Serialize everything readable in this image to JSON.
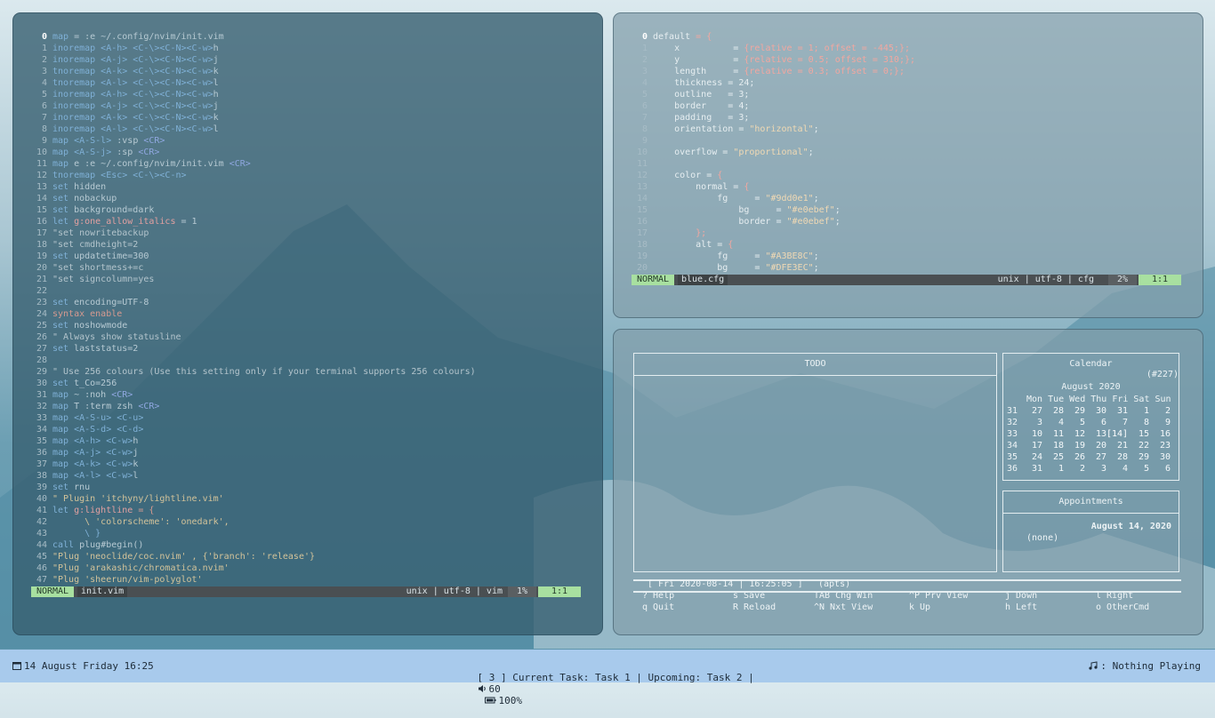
{
  "left": {
    "lines": [
      [
        {
          "t": "map",
          "c": "k"
        },
        {
          "t": " = :e ~/.config/nvim/init.vim",
          "c": "ct"
        }
      ],
      [
        {
          "t": "inoremap <A-h> <C-\\><C-N><C-w>",
          "c": "k"
        },
        {
          "t": "h",
          "c": "ct"
        }
      ],
      [
        {
          "t": "inoremap <A-j> <C-\\><C-N><C-w>",
          "c": "k"
        },
        {
          "t": "j",
          "c": "ct"
        }
      ],
      [
        {
          "t": "tnoremap <A-k> <C-\\><C-N><C-w>",
          "c": "k"
        },
        {
          "t": "k",
          "c": "ct"
        }
      ],
      [
        {
          "t": "tnoremap <A-l> <C-\\><C-N><C-w>",
          "c": "k"
        },
        {
          "t": "l",
          "c": "ct"
        }
      ],
      [
        {
          "t": "inoremap <A-h> <C-\\><C-N><C-w>",
          "c": "k"
        },
        {
          "t": "h",
          "c": "ct"
        }
      ],
      [
        {
          "t": "inoremap <A-j> <C-\\><C-N><C-w>",
          "c": "k"
        },
        {
          "t": "j",
          "c": "ct"
        }
      ],
      [
        {
          "t": "inoremap <A-k> <C-\\><C-N><C-w>",
          "c": "k"
        },
        {
          "t": "k",
          "c": "ct"
        }
      ],
      [
        {
          "t": "inoremap <A-l> <C-\\><C-N><C-w>",
          "c": "k"
        },
        {
          "t": "l",
          "c": "ct"
        }
      ],
      [
        {
          "t": "map <A-S-l>",
          "c": "k"
        },
        {
          "t": " :vsp ",
          "c": "ct"
        },
        {
          "t": "<CR>",
          "c": "m"
        }
      ],
      [
        {
          "t": "map <A-S-j>",
          "c": "k"
        },
        {
          "t": " :sp ",
          "c": "ct"
        },
        {
          "t": "<CR>",
          "c": "m"
        }
      ],
      [
        {
          "t": "map",
          "c": "k"
        },
        {
          "t": " e :e ~/.config/nvim/init.vim ",
          "c": "ct"
        },
        {
          "t": "<CR>",
          "c": "m"
        }
      ],
      [
        {
          "t": "tnoremap <Esc> <C-\\><C-n>",
          "c": "k"
        }
      ],
      [
        {
          "t": "set",
          "c": "k"
        },
        {
          "t": " hidden",
          "c": "ct"
        }
      ],
      [
        {
          "t": "set",
          "c": "k"
        },
        {
          "t": " nobackup",
          "c": "ct"
        }
      ],
      [
        {
          "t": "set",
          "c": "k"
        },
        {
          "t": " background=dark",
          "c": "ct"
        }
      ],
      [
        {
          "t": "let",
          "c": "k"
        },
        {
          "t": " g:one_allow_italics",
          "c": "n"
        },
        {
          "t": " = 1",
          "c": "ct"
        }
      ],
      [
        {
          "t": "\"set nowritebackup",
          "c": "c"
        }
      ],
      [
        {
          "t": "\"set cmdheight=2",
          "c": "c"
        }
      ],
      [
        {
          "t": "set",
          "c": "k"
        },
        {
          "t": " updatetime=300",
          "c": "ct"
        }
      ],
      [
        {
          "t": "\"set shortmess+=c",
          "c": "c"
        }
      ],
      [
        {
          "t": "\"set signcolumn=yes",
          "c": "c"
        }
      ],
      [
        {
          "t": "",
          "c": "ct"
        }
      ],
      [
        {
          "t": "set",
          "c": "k"
        },
        {
          "t": " encoding=UTF-8",
          "c": "ct"
        }
      ],
      [
        {
          "t": "syntax",
          "c": "o"
        },
        {
          "t": " enable",
          "c": "o"
        }
      ],
      [
        {
          "t": "set",
          "c": "k"
        },
        {
          "t": " noshowmode",
          "c": "ct"
        }
      ],
      [
        {
          "t": "\" Always show statusline",
          "c": "c"
        }
      ],
      [
        {
          "t": "set",
          "c": "k"
        },
        {
          "t": " laststatus=2",
          "c": "ct"
        }
      ],
      [
        {
          "t": "",
          "c": "ct"
        }
      ],
      [
        {
          "t": "\" Use 256 colours (Use this setting only if your terminal supports 256 colours)",
          "c": "c"
        }
      ],
      [
        {
          "t": "set",
          "c": "k"
        },
        {
          "t": " t_Co=256",
          "c": "ct"
        }
      ],
      [
        {
          "t": "map",
          "c": "k"
        },
        {
          "t": " ~ :noh ",
          "c": "ct"
        },
        {
          "t": "<CR>",
          "c": "m"
        }
      ],
      [
        {
          "t": "map",
          "c": "k"
        },
        {
          "t": " T :term zsh ",
          "c": "ct"
        },
        {
          "t": "<CR>",
          "c": "m"
        }
      ],
      [
        {
          "t": "map <A-S-u> <C-u>",
          "c": "k"
        }
      ],
      [
        {
          "t": "map <A-S-d> <C-d>",
          "c": "k"
        }
      ],
      [
        {
          "t": "map <A-h> <C-w>",
          "c": "k"
        },
        {
          "t": "h",
          "c": "ct"
        }
      ],
      [
        {
          "t": "map <A-j> <C-w>",
          "c": "k"
        },
        {
          "t": "j",
          "c": "ct"
        }
      ],
      [
        {
          "t": "map <A-k> <C-w>",
          "c": "k"
        },
        {
          "t": "k",
          "c": "ct"
        }
      ],
      [
        {
          "t": "map <A-l> <C-w>",
          "c": "k"
        },
        {
          "t": "l",
          "c": "ct"
        }
      ],
      [
        {
          "t": "set",
          "c": "k"
        },
        {
          "t": " rnu",
          "c": "ct"
        }
      ],
      [
        {
          "t": "\" Plugin 'itchyny/lightline.vim'",
          "c": "s"
        }
      ],
      [
        {
          "t": "let",
          "c": "k"
        },
        {
          "t": " g:lightline",
          "c": "n"
        },
        {
          "t": " = {",
          "c": "o"
        }
      ],
      [
        {
          "t": "      \\ 'colorscheme': 'onedark',",
          "c": "s"
        }
      ],
      [
        {
          "t": "      \\ }",
          "c": "k"
        }
      ],
      [
        {
          "t": "call",
          "c": "k"
        },
        {
          "t": " plug#begin()",
          "c": "ct"
        }
      ],
      [
        {
          "t": "\"Plug 'neoclide/coc.nvim' , {'branch': 'release'}",
          "c": "s"
        }
      ],
      [
        {
          "t": "\"Plug 'arakashic/chromatica.nvim'",
          "c": "s"
        }
      ],
      [
        {
          "t": "\"Plug 'sheerun/vim-polyglot'",
          "c": "s"
        }
      ]
    ],
    "status": {
      "mode": "NORMAL",
      "file": "init.vim",
      "info": "unix | utf-8 | vim",
      "pct": "1%",
      "pos": "1:1"
    }
  },
  "topright": {
    "lines": [
      [
        {
          "t": "default",
          "c": "cfgtext"
        },
        {
          "t": " = {",
          "c": "cfgpunc"
        }
      ],
      [
        {
          "t": "    x          = ",
          "c": "cfgtext"
        },
        {
          "t": "{relative = 1; offset = -445;};",
          "c": "cfgpunc"
        }
      ],
      [
        {
          "t": "    y          = ",
          "c": "cfgtext"
        },
        {
          "t": "{relative = 0.5; offset = 310;};",
          "c": "cfgpunc"
        }
      ],
      [
        {
          "t": "    length     = ",
          "c": "cfgtext"
        },
        {
          "t": "{relative = 0.3; offset = 0;};",
          "c": "cfgpunc"
        }
      ],
      [
        {
          "t": "    thickness = 24;",
          "c": "cfgtext"
        }
      ],
      [
        {
          "t": "    outline   = 3;",
          "c": "cfgtext"
        }
      ],
      [
        {
          "t": "    border    = 4;",
          "c": "cfgtext"
        }
      ],
      [
        {
          "t": "    padding   = 3;",
          "c": "cfgtext"
        }
      ],
      [
        {
          "t": "    orientation = ",
          "c": "cfgtext"
        },
        {
          "t": "\"horizontal\"",
          "c": "cfgstr"
        },
        {
          "t": ";",
          "c": "cfgtext"
        }
      ],
      [
        {
          "t": "",
          "c": "cfgtext"
        }
      ],
      [
        {
          "t": "    overflow = ",
          "c": "cfgtext"
        },
        {
          "t": "\"proportional\"",
          "c": "cfgstr"
        },
        {
          "t": ";",
          "c": "cfgtext"
        }
      ],
      [
        {
          "t": "",
          "c": "cfgtext"
        }
      ],
      [
        {
          "t": "    color = ",
          "c": "cfgtext"
        },
        {
          "t": "{",
          "c": "cfgpunc"
        }
      ],
      [
        {
          "t": "        normal = ",
          "c": "cfgtext"
        },
        {
          "t": "{",
          "c": "cfgpunc"
        }
      ],
      [
        {
          "t": "            fg     = ",
          "c": "cfgtext"
        },
        {
          "t": "\"#9dd0e1\"",
          "c": "cfgstr"
        },
        {
          "t": ";",
          "c": "cfgtext"
        }
      ],
      [
        {
          "t": "                bg     = ",
          "c": "cfgtext"
        },
        {
          "t": "\"#e0ebef\"",
          "c": "cfgstr"
        },
        {
          "t": ";",
          "c": "cfgtext"
        }
      ],
      [
        {
          "t": "                border = ",
          "c": "cfgtext"
        },
        {
          "t": "\"#e0ebef\"",
          "c": "cfgstr"
        },
        {
          "t": ";",
          "c": "cfgtext"
        }
      ],
      [
        {
          "t": "        };",
          "c": "cfgpunc"
        }
      ],
      [
        {
          "t": "        alt = ",
          "c": "cfgtext"
        },
        {
          "t": "{",
          "c": "cfgpunc"
        }
      ],
      [
        {
          "t": "            fg     = ",
          "c": "cfgtext"
        },
        {
          "t": "\"#A3BE8C\"",
          "c": "cfgstr"
        },
        {
          "t": ";",
          "c": "cfgtext"
        }
      ],
      [
        {
          "t": "            bg     = ",
          "c": "cfgtext"
        },
        {
          "t": "\"#DFE3EC\"",
          "c": "cfgstr"
        },
        {
          "t": ";",
          "c": "cfgtext"
        }
      ]
    ],
    "status": {
      "mode": "NORMAL",
      "file": "blue.cfg",
      "info": "unix | utf-8 | cfg",
      "pct": "2%",
      "pos": "1:1"
    }
  },
  "calcurse": {
    "todo_title": "TODO",
    "cal_title": "Calendar",
    "cal_tag": "(#227)",
    "month": "August 2020",
    "weekdays": "Mon Tue Wed Thu Fri Sat Sun",
    "weeks": [
      {
        "wk": "31",
        "days": [
          "27",
          "28",
          "29",
          "30",
          "31",
          "1",
          "2"
        ]
      },
      {
        "wk": "32",
        "days": [
          "3",
          "4",
          "5",
          "6",
          "7",
          "8",
          "9"
        ]
      },
      {
        "wk": "33",
        "days": [
          "10",
          "11",
          "12",
          "13",
          "[14]",
          "15",
          "16"
        ]
      },
      {
        "wk": "34",
        "days": [
          "17",
          "18",
          "19",
          "20",
          "21",
          "22",
          "23"
        ]
      },
      {
        "wk": "35",
        "days": [
          "24",
          "25",
          "26",
          "27",
          "28",
          "29",
          "30"
        ]
      },
      {
        "wk": "36",
        "days": [
          "31",
          "1",
          "2",
          "3",
          "4",
          "5",
          "6"
        ]
      }
    ],
    "appt_title": "Appointments",
    "appt_date": "August 14, 2020",
    "appt_none": "(none)",
    "status_line": "[ Fri 2020-08-14 | 16:25:05 ]",
    "status_tag": "(apts)",
    "keys": [
      [
        "? Help",
        "s Save",
        "TAB Chg Win",
        "^P Prv View",
        "j Down",
        "l Right"
      ],
      [
        "q Quit",
        "R Reload",
        "^N Nxt View",
        "k Up",
        "h Left",
        "o OtherCmd"
      ]
    ]
  },
  "taskbar": {
    "date": "14 August Friday 16:25",
    "tasks": "[ 3 ] Current Task: Task 1 | Upcoming: Task 2 |",
    "volume": "60",
    "battery": "100%",
    "music": ": Nothing Playing"
  }
}
